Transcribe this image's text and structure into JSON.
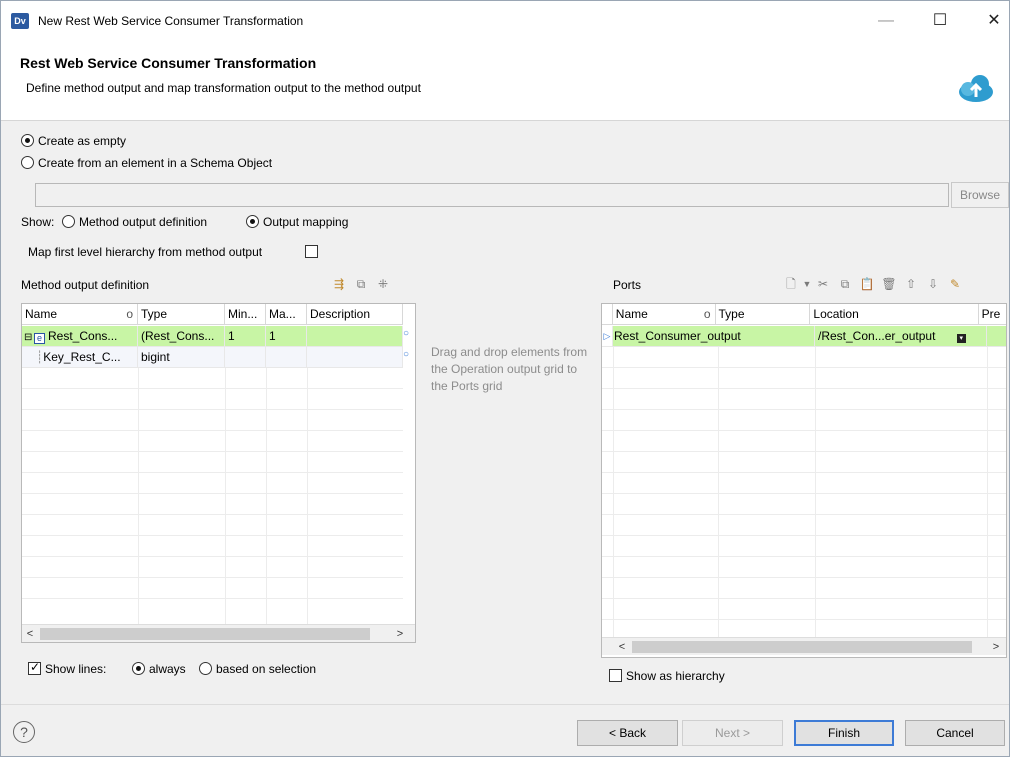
{
  "window": {
    "app_icon": "Dv",
    "title": "New Rest Web Service Consumer Transformation",
    "minimize": "—",
    "maximize": "☐",
    "close": "✕"
  },
  "header": {
    "title": "Rest Web Service Consumer Transformation",
    "subtitle": "Define method output and map transformation output to the method output",
    "icon": "cloud-gear-icon"
  },
  "create_options": {
    "empty_label": "Create as empty",
    "empty_selected": true,
    "schema_label": "Create from an element in a Schema Object",
    "path_value": "",
    "browse_label": "Browse"
  },
  "show": {
    "label": "Show:",
    "method_output_label": "Method output definition",
    "output_mapping_label": "Output mapping",
    "selected": "Output mapping"
  },
  "map_first_level": {
    "label": "Map first level hierarchy from method output",
    "checked": false
  },
  "method_output": {
    "label": "Method output definition",
    "columns": [
      "Name",
      "o",
      "Type",
      "Min...",
      "Ma...",
      "Description"
    ],
    "rows": [
      {
        "name": "Rest_Cons...",
        "type": "(Rest_Cons...",
        "min": "1",
        "max": "1",
        "description": ""
      },
      {
        "name": "Key_Rest_C...",
        "type": "bigint",
        "min": "",
        "max": "",
        "description": ""
      }
    ],
    "row_badge": "e",
    "expander": "⊟"
  },
  "drag_hint": "Drag and drop elements from the Operation output grid to the Ports grid",
  "ports": {
    "label": "Ports",
    "columns": [
      "Name",
      "o",
      "Type",
      "Location",
      "Pre"
    ],
    "rows": [
      {
        "name": "Rest_Consumer_output",
        "type": "",
        "location": "/Rest_Con...er_output"
      }
    ]
  },
  "show_lines": {
    "label": "Show lines:",
    "checked": true,
    "always_label": "always",
    "selection_label": "based on selection"
  },
  "show_hierarchy": {
    "label": "Show as hierarchy",
    "checked": false
  },
  "buttons": {
    "help": "?",
    "back": "< Back",
    "next": "Next >",
    "finish": "Finish",
    "cancel": "Cancel"
  }
}
